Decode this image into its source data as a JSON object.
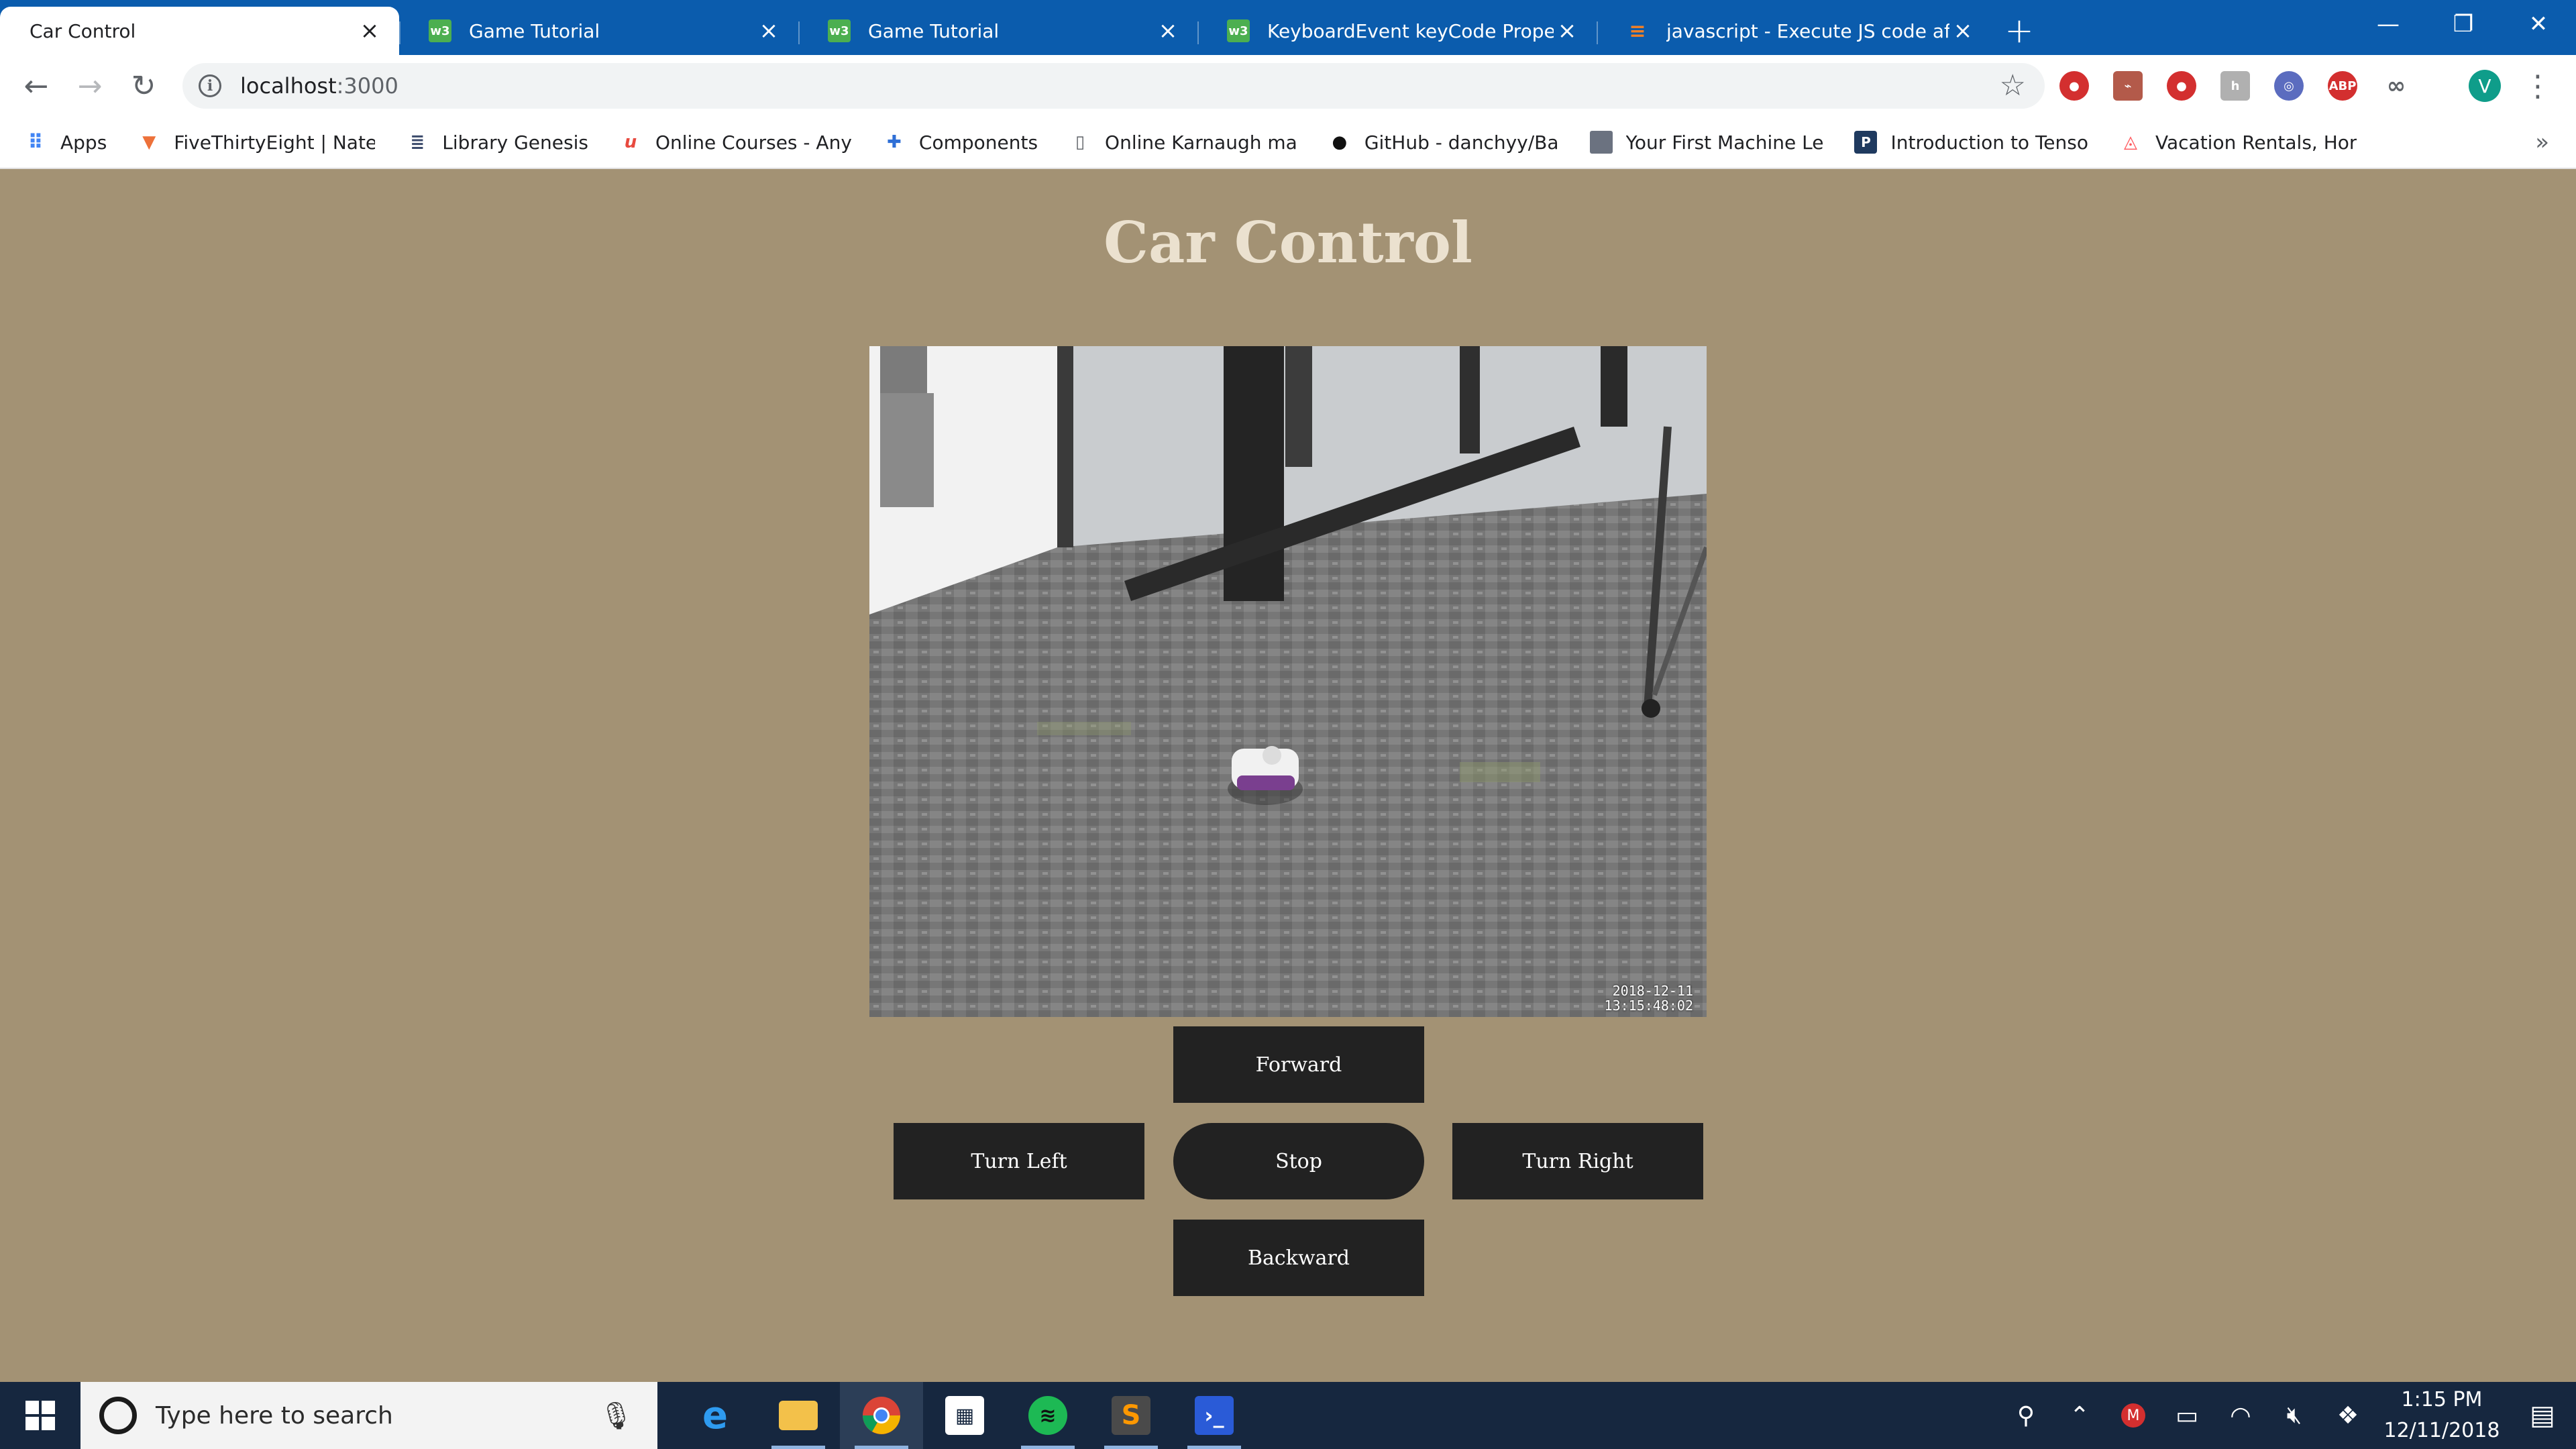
{
  "browser": {
    "tabs": [
      {
        "title": "Car Control",
        "favicon": "page-icon",
        "active": true
      },
      {
        "title": "Game Tutorial",
        "favicon": "w3schools-icon",
        "active": false
      },
      {
        "title": "Game Tutorial",
        "favicon": "w3schools-icon",
        "active": false
      },
      {
        "title": "KeyboardEvent keyCode Property",
        "favicon": "w3schools-icon",
        "active": false
      },
      {
        "title": "javascript - Execute JS code after",
        "favicon": "stackoverflow-icon",
        "active": false
      }
    ],
    "new_tab_label": "+",
    "url": {
      "host": "localhost",
      "port": ":3000"
    },
    "profile_initial": "V",
    "bookmarks": [
      {
        "label": "Apps",
        "icon": "apps-grid-icon"
      },
      {
        "label": "FiveThirtyEight | Nate",
        "icon": "fivethirtyeight-icon"
      },
      {
        "label": "Library Genesis",
        "icon": "library-genesis-icon"
      },
      {
        "label": "Online Courses - Any",
        "icon": "udemy-icon"
      },
      {
        "label": "Components",
        "icon": "puzzle-icon"
      },
      {
        "label": "Online Karnaugh ma",
        "icon": "page-icon"
      },
      {
        "label": "GitHub - danchyy/Ba",
        "icon": "github-icon"
      },
      {
        "label": "Your First Machine Le",
        "icon": "avatar-icon"
      },
      {
        "label": "Introduction to Tenso",
        "icon": "tensorflow-icon"
      },
      {
        "label": "Vacation Rentals, Hor",
        "icon": "airbnb-icon"
      }
    ],
    "bookmarks_overflow": "»"
  },
  "page": {
    "title": "Car Control",
    "video_timestamp": {
      "line1": "2018-12-11",
      "line2": "13:15:48:02"
    },
    "controls": {
      "forward": "Forward",
      "turn_left": "Turn Left",
      "stop": "Stop",
      "turn_right": "Turn Right",
      "backward": "Backward"
    },
    "colors": {
      "background": "#a39274",
      "title": "#ebe1cf",
      "button": "#222222"
    }
  },
  "taskbar": {
    "search_placeholder": "Type here to search",
    "apps": [
      "edge-icon",
      "file-explorer-icon",
      "chrome-icon",
      "store-icon",
      "spotify-icon",
      "sublime-text-icon",
      "powershell-icon"
    ],
    "clock": {
      "time": "1:15 PM",
      "date": "12/11/2018"
    }
  }
}
